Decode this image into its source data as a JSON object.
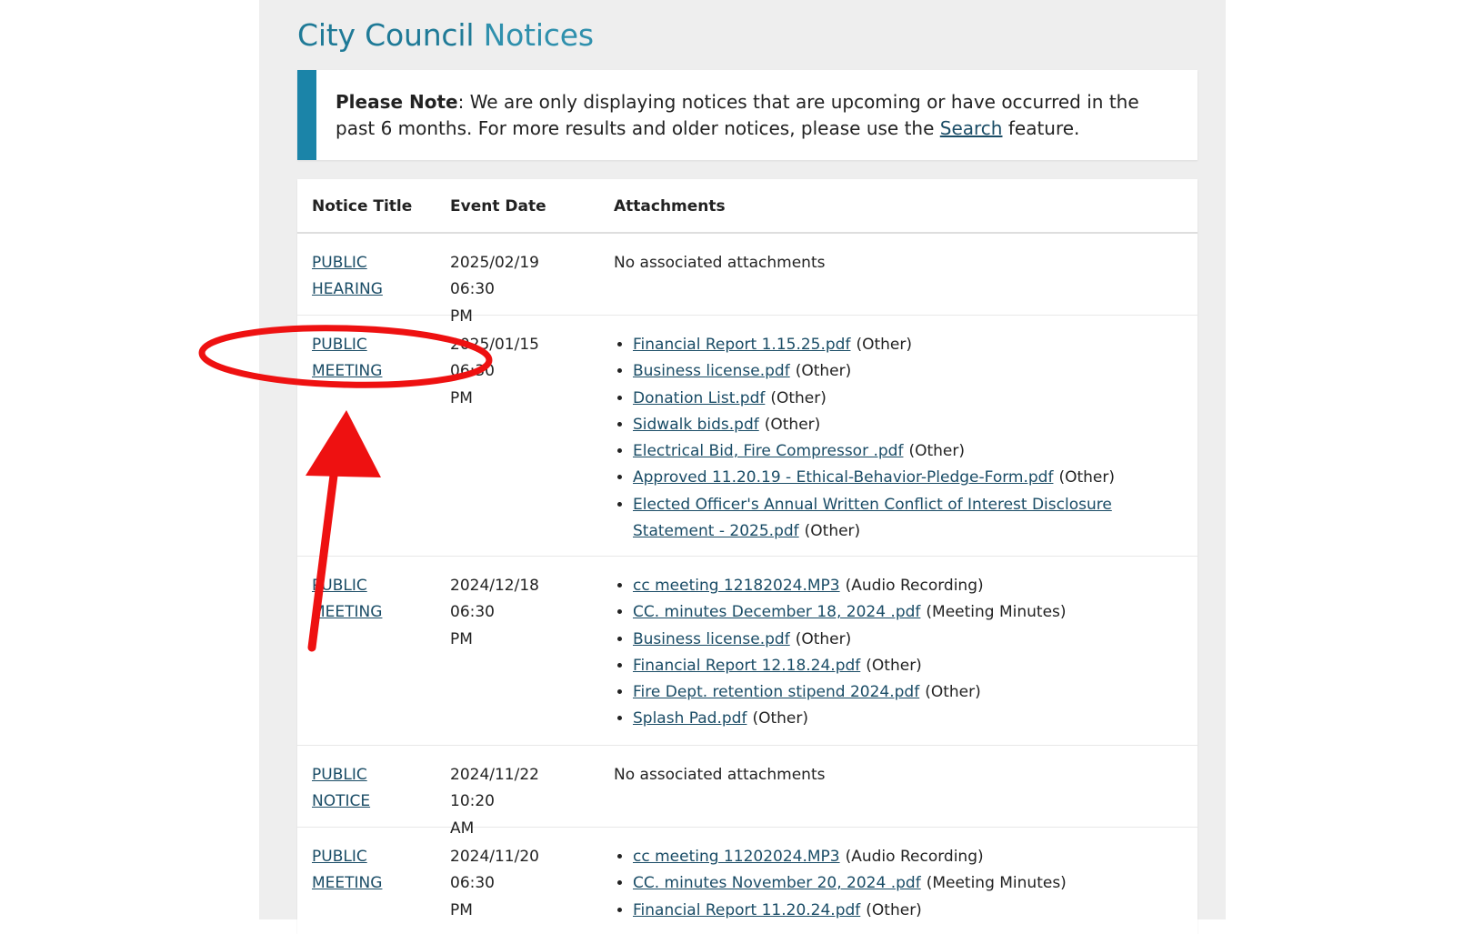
{
  "page": {
    "title_part1": "City Council",
    "title_part2": "Notices"
  },
  "note": {
    "bold": "Please Note",
    "text_before": ": We are only displaying notices that are upcoming or have occurred in the past 6 months. For more results and older notices, please use the ",
    "link": "Search",
    "text_after": " feature."
  },
  "table": {
    "headers": [
      "Notice Title",
      "Event Date",
      "Attachments"
    ],
    "rows": [
      {
        "title_line1": "PUBLIC",
        "title_line2": "HEARING",
        "date_line1": "2025/02/19 06:30",
        "date_line2": "PM",
        "no_attachments": "No associated attachments"
      },
      {
        "title_line1": "PUBLIC",
        "title_line2": "MEETING",
        "date_line1": "2025/01/15 06:30",
        "date_line2": "PM",
        "attachments": [
          {
            "name": "Financial Report 1.15.25.pdf",
            "type": "(Other)"
          },
          {
            "name": "Business license.pdf",
            "type": "(Other)"
          },
          {
            "name": "Donation List.pdf",
            "type": "(Other)"
          },
          {
            "name": "Sidwalk bids.pdf",
            "type": "(Other)"
          },
          {
            "name": "Electrical Bid, Fire Compressor .pdf",
            "type": "(Other)"
          },
          {
            "name": "Approved 11.20.19 - Ethical-Behavior-Pledge-Form.pdf",
            "type": "(Other)"
          },
          {
            "name": "Elected Officer's Annual Written Conflict of Interest Disclosure Statement - 2025.pdf",
            "type": "(Other)"
          }
        ]
      },
      {
        "title_line1": "PUBLIC",
        "title_line2": "MEETING",
        "date_line1": "2024/12/18 06:30",
        "date_line2": "PM",
        "attachments": [
          {
            "name": "cc meeting 12182024.MP3",
            "type": "(Audio Recording)"
          },
          {
            "name": "CC. minutes December 18, 2024 .pdf",
            "type": "(Meeting Minutes)"
          },
          {
            "name": "Business license.pdf",
            "type": "(Other)"
          },
          {
            "name": "Financial Report 12.18.24.pdf",
            "type": "(Other)"
          },
          {
            "name": "Fire Dept. retention stipend 2024.pdf",
            "type": "(Other)"
          },
          {
            "name": "Splash Pad.pdf",
            "type": "(Other)"
          }
        ]
      },
      {
        "title_line1": "PUBLIC",
        "title_line2": "NOTICE",
        "date_line1": "2024/11/22 10:20",
        "date_line2": "AM",
        "no_attachments": "No associated attachments"
      },
      {
        "title_line1": "PUBLIC",
        "title_line2": "MEETING",
        "date_line1": "2024/11/20 06:30",
        "date_line2": "PM",
        "attachments": [
          {
            "name": "cc meeting 11202024.MP3",
            "type": "(Audio Recording)"
          },
          {
            "name": "CC. minutes November 20, 2024 .pdf",
            "type": "(Meeting Minutes)"
          },
          {
            "name": "Financial Report 11.20.24.pdf",
            "type": "(Other)"
          }
        ]
      }
    ]
  },
  "annotation": {
    "color": "#ee1111",
    "shapes": [
      "ellipse-highlight",
      "arrow-up"
    ]
  },
  "colors": {
    "title": "#1f7a97",
    "note_bar": "#1b84a8",
    "link": "#1a4c66",
    "page_bg": "#eeeeee"
  }
}
